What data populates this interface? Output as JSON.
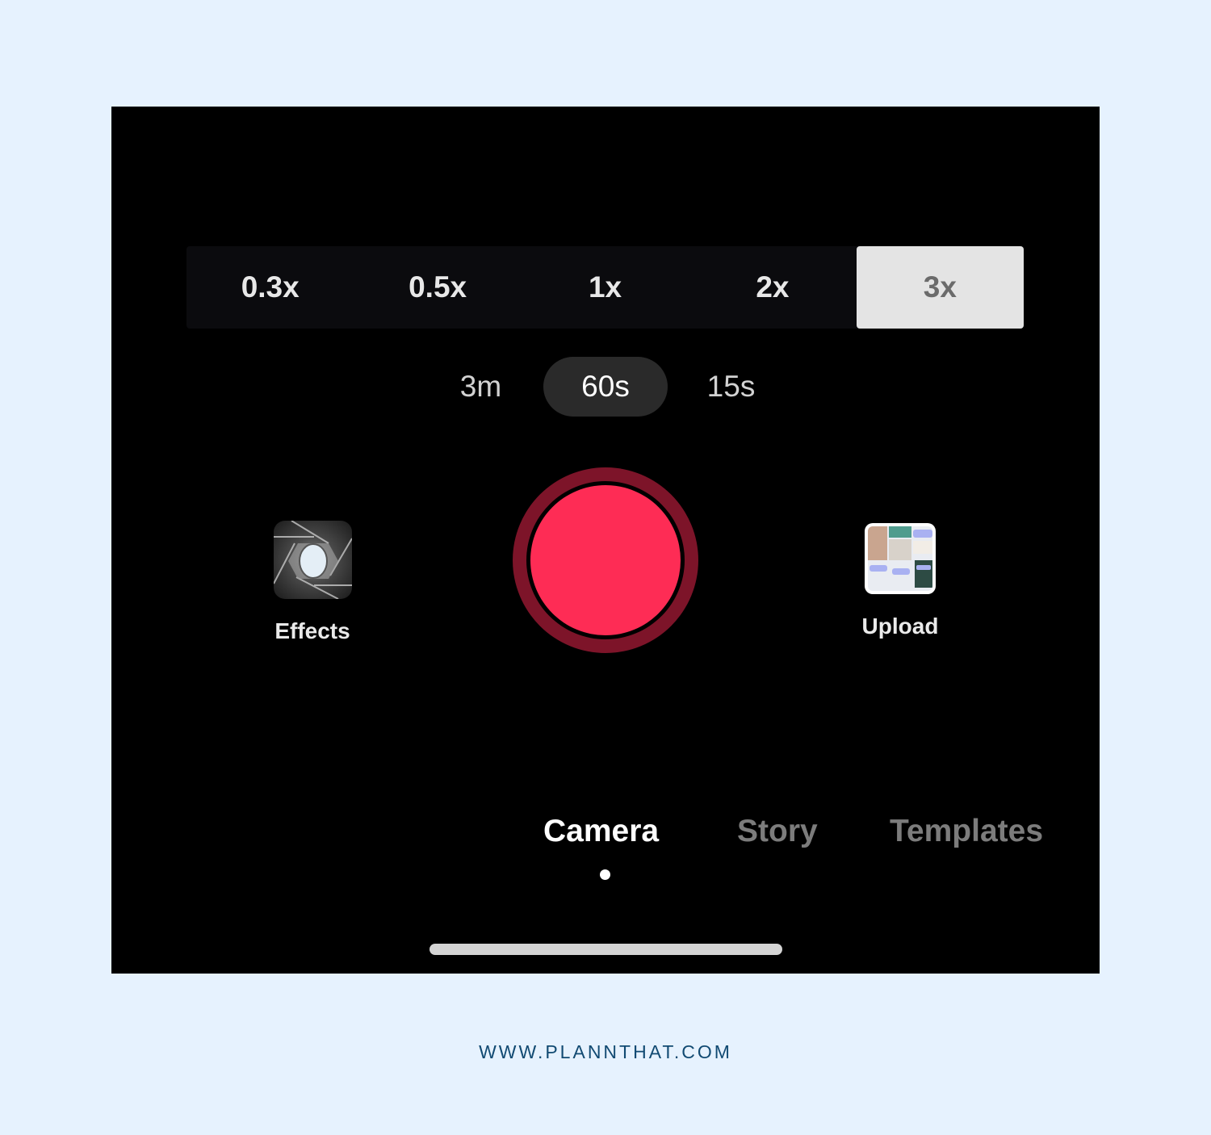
{
  "zoom_options": [
    {
      "label": "0.3x",
      "selected": false
    },
    {
      "label": "0.5x",
      "selected": false
    },
    {
      "label": "1x",
      "selected": false
    },
    {
      "label": "2x",
      "selected": false
    },
    {
      "label": "3x",
      "selected": true
    }
  ],
  "durations": [
    {
      "label": "3m",
      "selected": false
    },
    {
      "label": "60s",
      "selected": true
    },
    {
      "label": "15s",
      "selected": false
    }
  ],
  "effects": {
    "label": "Effects",
    "icon": "effects-aperture-icon"
  },
  "upload": {
    "label": "Upload",
    "icon": "gallery-thumbnail"
  },
  "record_button": {
    "icon": "record-icon",
    "color": "#fe2c55",
    "ring_color": "#7d1429"
  },
  "modes": [
    {
      "label": "Camera",
      "selected": true
    },
    {
      "label": "Story",
      "selected": false
    },
    {
      "label": "Templates",
      "selected": false
    }
  ],
  "footer": {
    "url": "WWW.PLANNTHAT.COM"
  },
  "colors": {
    "background": "#e6f2fe",
    "screen": "#000000",
    "accent": "#fe2c55",
    "footer_text": "#114a72"
  }
}
